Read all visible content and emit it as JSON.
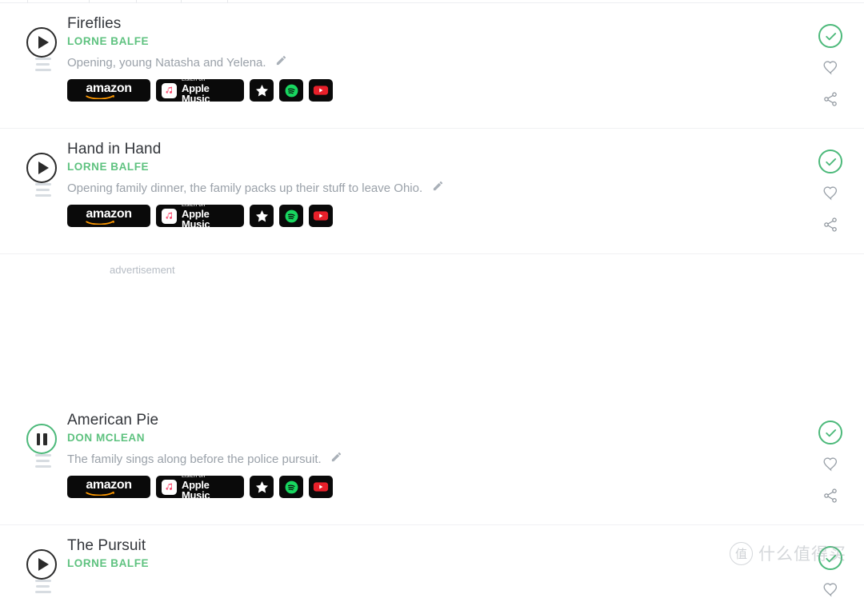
{
  "advertisement": {
    "label": "advertisement"
  },
  "watermark": {
    "mark": "值",
    "text": "什么值得买"
  },
  "services": {
    "amazon": "amazon",
    "apple_line1": "Listen on",
    "apple_line2": "Apple Music",
    "star": "star-badge",
    "spotify": "spotify-badge",
    "youtube": "youtube-badge"
  },
  "tracks": [
    {
      "title": "Fireflies",
      "artist": "LORNE BALFE",
      "description": "Opening, young Natasha and Yelena.",
      "state": "play"
    },
    {
      "title": "Hand in Hand",
      "artist": "LORNE BALFE",
      "description": "Opening family dinner, the family packs up their stuff to leave Ohio.",
      "state": "play"
    },
    {
      "title": "American Pie",
      "artist": "DON MCLEAN",
      "description": "The family sings along before the police pursuit.",
      "state": "pause"
    },
    {
      "title": "The Pursuit",
      "artist": "LORNE BALFE",
      "description": "",
      "state": "play"
    }
  ]
}
